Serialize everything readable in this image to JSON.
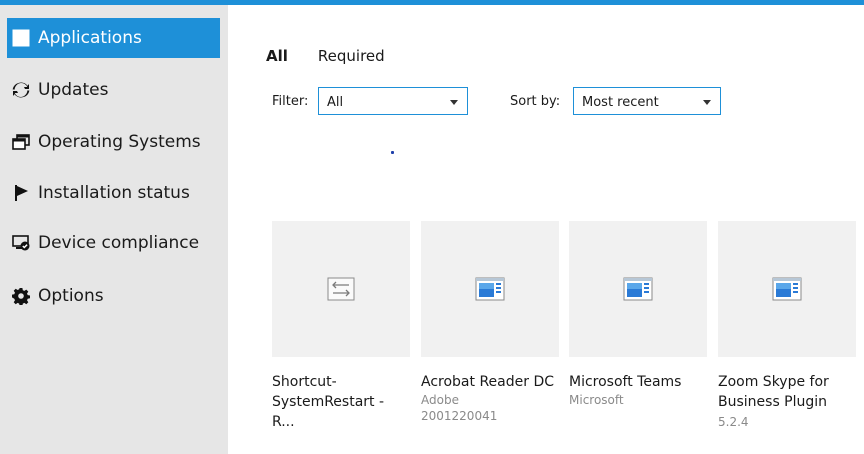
{
  "sidebar": {
    "items": [
      {
        "label": "Applications",
        "icon": "applications-icon",
        "active": true
      },
      {
        "label": "Updates",
        "icon": "refresh-icon"
      },
      {
        "label": "Operating Systems",
        "icon": "windows-stack-icon"
      },
      {
        "label": "Installation status",
        "icon": "flag-icon"
      },
      {
        "label": "Device compliance",
        "icon": "device-check-icon"
      },
      {
        "label": "Options",
        "icon": "gear-icon"
      }
    ]
  },
  "tabs": [
    {
      "label": "All",
      "active": true
    },
    {
      "label": "Required"
    }
  ],
  "filters": {
    "filter_label": "Filter:",
    "filter_value": "All",
    "sort_label": "Sort by:",
    "sort_value": "Most recent"
  },
  "apps": [
    {
      "name": "Shortcut-\nSystemRestart - R...",
      "publisher": "",
      "version": "",
      "icon": "script-icon"
    },
    {
      "name": "Acrobat Reader DC",
      "publisher": "Adobe",
      "version": "2001220041",
      "icon": "app-window-icon"
    },
    {
      "name": "Microsoft Teams",
      "publisher": "Microsoft",
      "version": "",
      "icon": "app-window-icon"
    },
    {
      "name": "Zoom Skype for\nBusiness Plugin",
      "publisher": "",
      "version": "5.2.4",
      "icon": "app-window-icon"
    }
  ],
  "colors": {
    "accent": "#1e90d8",
    "sidebar_bg": "#e6e6e6",
    "card_bg": "#f1f1f1"
  }
}
